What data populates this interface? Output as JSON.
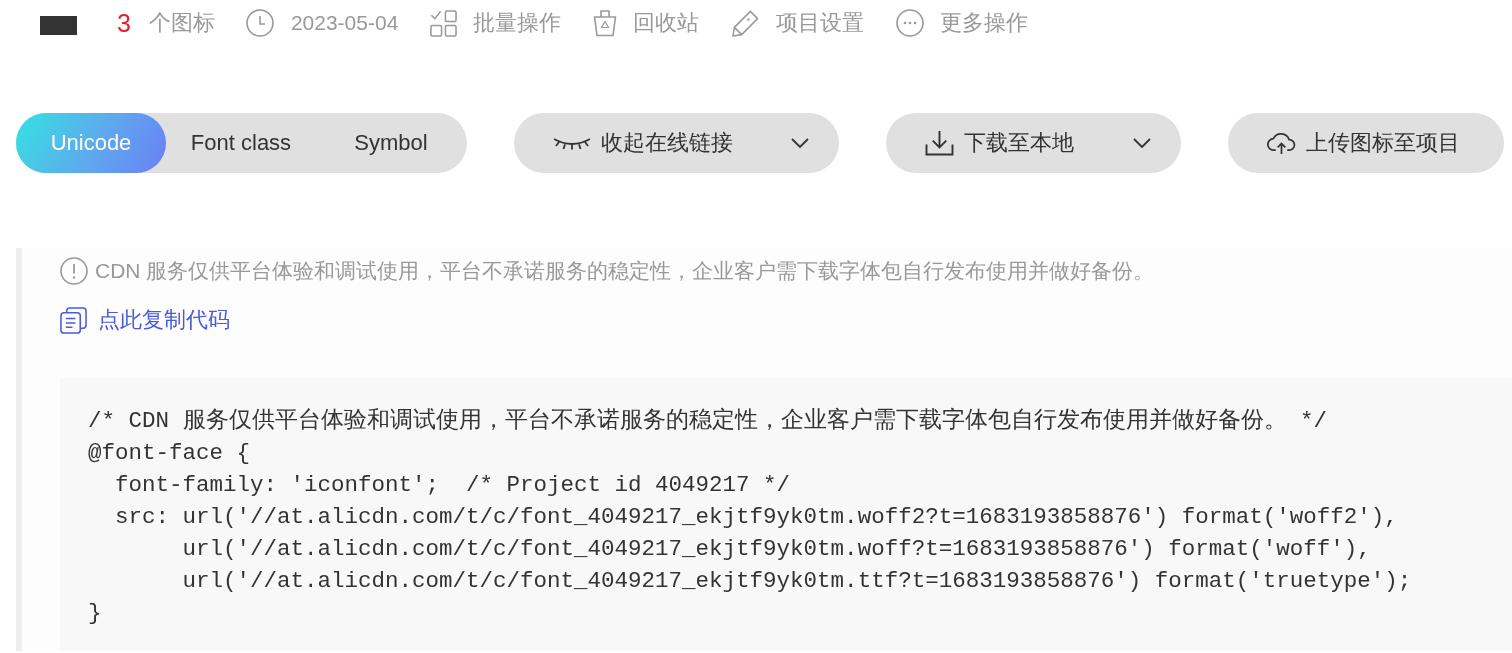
{
  "header": {
    "icon_count": "3",
    "icon_count_label": "个图标",
    "date": "2023-05-04",
    "actions": [
      {
        "label": "批量操作"
      },
      {
        "label": "回收站"
      },
      {
        "label": "项目设置"
      },
      {
        "label": "更多操作"
      }
    ]
  },
  "format_tabs": [
    {
      "label": "Unicode",
      "selected": true
    },
    {
      "label": "Font class",
      "selected": false
    },
    {
      "label": "Symbol",
      "selected": false
    }
  ],
  "toolbar_buttons": [
    {
      "label": "收起在线链接",
      "dropdown": true
    },
    {
      "label": "下载至本地",
      "dropdown": true
    },
    {
      "label": "上传图标至项目",
      "dropdown": false
    }
  ],
  "notice": {
    "text": "CDN 服务仅供平台体验和调试使用，平台不承诺服务的稳定性，企业客户需下载字体包自行发布使用并做好备份。",
    "copy_link": "点此复制代码"
  },
  "code_block": {
    "lines": [
      "/* CDN 服务仅供平台体验和调试使用，平台不承诺服务的稳定性，企业客户需下载字体包自行发布使用并做好备份。 */",
      "@font-face {",
      "  font-family: 'iconfont';  /* Project id 4049217 */",
      "  src: url('//at.alicdn.com/t/c/font_4049217_ekjtf9yk0tm.woff2?t=1683193858876') format('woff2'),",
      "       url('//at.alicdn.com/t/c/font_4049217_ekjtf9yk0tm.woff?t=1683193858876') format('woff'),",
      "       url('//at.alicdn.com/t/c/font_4049217_ekjtf9yk0tm.ttf?t=1683193858876') format('truetype');",
      "}"
    ]
  }
}
